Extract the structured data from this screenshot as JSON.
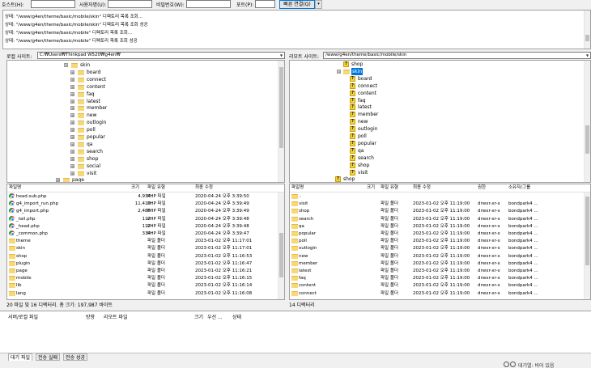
{
  "quick_connect": {
    "host_label": "호스트(H):",
    "user_label": "사용자명(U):",
    "pass_label": "비밀번호(W):",
    "port_label": "포트(P):",
    "connect_label": "빠른 연결(Q)",
    "dropdown_icon": "▾"
  },
  "log": [
    "상태: \"/www/g4en/theme/basic/mobile/skin\" 디렉토리 목록 조회...",
    "상태: \"/www/g4en/theme/basic/mobile/skin\" 디렉토리 목록 조회 성공",
    "상태: \"/www/g4en/theme/basic/mobile\" 디렉토리 목록 조회...",
    "상태: \"/www/g4en/theme/basic/mobile\" 디렉토리 목록 조회 성공"
  ],
  "local": {
    "site_label": "로컬 사이트:",
    "site_path": "C:₩Users₩Thinkpad W520₩g4en₩",
    "tree": [
      {
        "label": "skin",
        "level": 0,
        "expander": "⊟"
      },
      {
        "label": "board",
        "level": 1,
        "expander": "⊞"
      },
      {
        "label": "connect",
        "level": 1,
        "expander": "⊞"
      },
      {
        "label": "content",
        "level": 1,
        "expander": "⊞"
      },
      {
        "label": "faq",
        "level": 1,
        "expander": "⊞"
      },
      {
        "label": "latest",
        "level": 1,
        "expander": "⊞"
      },
      {
        "label": "member",
        "level": 1,
        "expander": "⊞"
      },
      {
        "label": "new",
        "level": 1,
        "expander": "⊞"
      },
      {
        "label": "outlogin",
        "level": 1,
        "expander": "⊞"
      },
      {
        "label": "poll",
        "level": 1,
        "expander": "⊞"
      },
      {
        "label": "popular",
        "level": 1,
        "expander": "⊞"
      },
      {
        "label": "qa",
        "level": 1,
        "expander": "⊞"
      },
      {
        "label": "search",
        "level": 1,
        "expander": "⊞"
      },
      {
        "label": "shop",
        "level": 1,
        "expander": "⊞"
      },
      {
        "label": "social",
        "level": 1,
        "expander": "⊞"
      },
      {
        "label": "visit",
        "level": 1,
        "expander": "⊞"
      },
      {
        "label": "page",
        "level": -1,
        "expander": "⊞"
      }
    ],
    "columns": [
      "파일명",
      "크기",
      "파일 유형",
      "최종 수정"
    ],
    "files": [
      {
        "name": "head.sub.php",
        "size": "4,934",
        "type": "PHP 파일",
        "modified": "2020-04-24 오후 3:39:50",
        "icon": "chrome"
      },
      {
        "name": "g4_import_run.php",
        "size": "11,419",
        "type": "PHP 파일",
        "modified": "2020-04-24 오후 3:39:49",
        "icon": "chrome"
      },
      {
        "name": "g4_import.php",
        "size": "2,485",
        "type": "PHP 파일",
        "modified": "2020-04-24 오후 3:39:49",
        "icon": "chrome"
      },
      {
        "name": "_tail.php",
        "size": "112",
        "type": "PHP 파일",
        "modified": "2020-04-24 오후 3:39:48",
        "icon": "chrome"
      },
      {
        "name": "_head.php",
        "size": "112",
        "type": "PHP 파일",
        "modified": "2020-04-24 오후 3:39:48",
        "icon": "chrome"
      },
      {
        "name": "_common.php",
        "size": "334",
        "type": "PHP 파일",
        "modified": "2020-04-24 오후 3:39:47",
        "icon": "chrome"
      },
      {
        "name": "theme",
        "size": "",
        "type": "파일 폴더",
        "modified": "2023-01-02 오후 11:17:01",
        "icon": "folder"
      },
      {
        "name": "skin",
        "size": "",
        "type": "파일 폴더",
        "modified": "2023-01-02 오후 11:17:01",
        "icon": "folder"
      },
      {
        "name": "shop",
        "size": "",
        "type": "파일 폴더",
        "modified": "2023-01-02 오후 11:16:53",
        "icon": "folder"
      },
      {
        "name": "plugin",
        "size": "",
        "type": "파일 폴더",
        "modified": "2023-01-02 오후 11:16:47",
        "icon": "folder"
      },
      {
        "name": "page",
        "size": "",
        "type": "파일 폴더",
        "modified": "2023-01-02 오후 11:16:21",
        "icon": "folder"
      },
      {
        "name": "mobile",
        "size": "",
        "type": "파일 폴더",
        "modified": "2023-01-02 오후 11:16:15",
        "icon": "folder"
      },
      {
        "name": "lib",
        "size": "",
        "type": "파일 폴더",
        "modified": "2023-01-02 오후 11:16:14",
        "icon": "folder"
      },
      {
        "name": "lang",
        "size": "",
        "type": "파일 폴더",
        "modified": "2023-01-02 오후 11:16:08",
        "icon": "folder"
      }
    ],
    "status": "20 파일 및 16 디렉터리. 총 크기: 197,987 바이트"
  },
  "remote": {
    "site_label": "리모트 사이트:",
    "site_path": "/www/g4en/theme/basic/mobile/skin",
    "tree": [
      {
        "label": "shop",
        "level": 0,
        "kind": "q",
        "selected": false
      },
      {
        "label": "skin",
        "level": 0,
        "kind": "folder",
        "selected": true
      },
      {
        "label": "board",
        "level": 1,
        "kind": "q",
        "selected": false
      },
      {
        "label": "connect",
        "level": 1,
        "kind": "q",
        "selected": false
      },
      {
        "label": "content",
        "level": 1,
        "kind": "q",
        "selected": false
      },
      {
        "label": "faq",
        "level": 1,
        "kind": "q",
        "selected": false
      },
      {
        "label": "latest",
        "level": 1,
        "kind": "q",
        "selected": false
      },
      {
        "label": "member",
        "level": 1,
        "kind": "q",
        "selected": false
      },
      {
        "label": "new",
        "level": 1,
        "kind": "q",
        "selected": false
      },
      {
        "label": "outlogin",
        "level": 1,
        "kind": "q",
        "selected": false
      },
      {
        "label": "poll",
        "level": 1,
        "kind": "q",
        "selected": false
      },
      {
        "label": "popular",
        "level": 1,
        "kind": "q",
        "selected": false
      },
      {
        "label": "qa",
        "level": 1,
        "kind": "q",
        "selected": false
      },
      {
        "label": "search",
        "level": 1,
        "kind": "q",
        "selected": false
      },
      {
        "label": "shop",
        "level": 1,
        "kind": "q",
        "selected": false
      },
      {
        "label": "visit",
        "level": 1,
        "kind": "q",
        "selected": false
      },
      {
        "label": "shop",
        "level": -1,
        "kind": "q",
        "selected": false
      }
    ],
    "columns": [
      "파일명",
      "크기",
      "파일 유형",
      "최종 수정",
      "권한",
      "소유자/그룹"
    ],
    "files": [
      {
        "name": "..",
        "type": "",
        "modified": "",
        "perm": "",
        "owner": ""
      },
      {
        "name": "visit",
        "type": "파일 폴더",
        "modified": "2023-01-02 오후 11:19:00",
        "perm": "drwxr-xr-x",
        "owner": "bondpark4 ..."
      },
      {
        "name": "shop",
        "type": "파일 폴더",
        "modified": "2023-01-02 오후 11:19:00",
        "perm": "drwxr-xr-x",
        "owner": "bondpark4 ..."
      },
      {
        "name": "search",
        "type": "파일 폴더",
        "modified": "2023-01-02 오후 11:19:00",
        "perm": "drwxr-xr-x",
        "owner": "bondpark4 ..."
      },
      {
        "name": "qa",
        "type": "파일 폴더",
        "modified": "2023-01-02 오후 11:19:00",
        "perm": "drwxr-xr-x",
        "owner": "bondpark4 ..."
      },
      {
        "name": "popular",
        "type": "파일 폴더",
        "modified": "2023-01-02 오후 11:19:00",
        "perm": "drwxr-xr-x",
        "owner": "bondpark4 ..."
      },
      {
        "name": "poll",
        "type": "파일 폴더",
        "modified": "2023-01-02 오후 11:19:00",
        "perm": "drwxr-xr-x",
        "owner": "bondpark4 ..."
      },
      {
        "name": "outlogin",
        "type": "파일 폴더",
        "modified": "2023-01-02 오후 11:19:00",
        "perm": "drwxr-xr-x",
        "owner": "bondpark4 ..."
      },
      {
        "name": "new",
        "type": "파일 폴더",
        "modified": "2023-01-02 오후 11:19:00",
        "perm": "drwxr-xr-x",
        "owner": "bondpark4 ..."
      },
      {
        "name": "member",
        "type": "파일 폴더",
        "modified": "2023-01-02 오후 11:19:00",
        "perm": "drwxr-xr-x",
        "owner": "bondpark4 ..."
      },
      {
        "name": "latest",
        "type": "파일 폴더",
        "modified": "2023-01-02 오후 11:19:00",
        "perm": "drwxr-xr-x",
        "owner": "bondpark4 ..."
      },
      {
        "name": "faq",
        "type": "파일 폴더",
        "modified": "2023-01-02 오후 11:19:00",
        "perm": "drwxr-xr-x",
        "owner": "bondpark4 ..."
      },
      {
        "name": "content",
        "type": "파일 폴더",
        "modified": "2023-01-02 오후 11:19:00",
        "perm": "drwxr-xr-x",
        "owner": "bondpark4 ..."
      },
      {
        "name": "connect",
        "type": "파일 폴더",
        "modified": "2023-01-02 오후 11:19:00",
        "perm": "drwxr-xr-x",
        "owner": "bondpark4 ..."
      }
    ],
    "status": "14 디렉터리"
  },
  "queue": {
    "columns": [
      "서버/로컬 파일",
      "방향",
      "리모트 파일",
      "크기",
      "우선 ...",
      "상태"
    ]
  },
  "tabs": [
    "대기 파일",
    "전송 실패",
    "전송 성공"
  ],
  "bottom": {
    "text": "대기열: 비어 있음"
  }
}
